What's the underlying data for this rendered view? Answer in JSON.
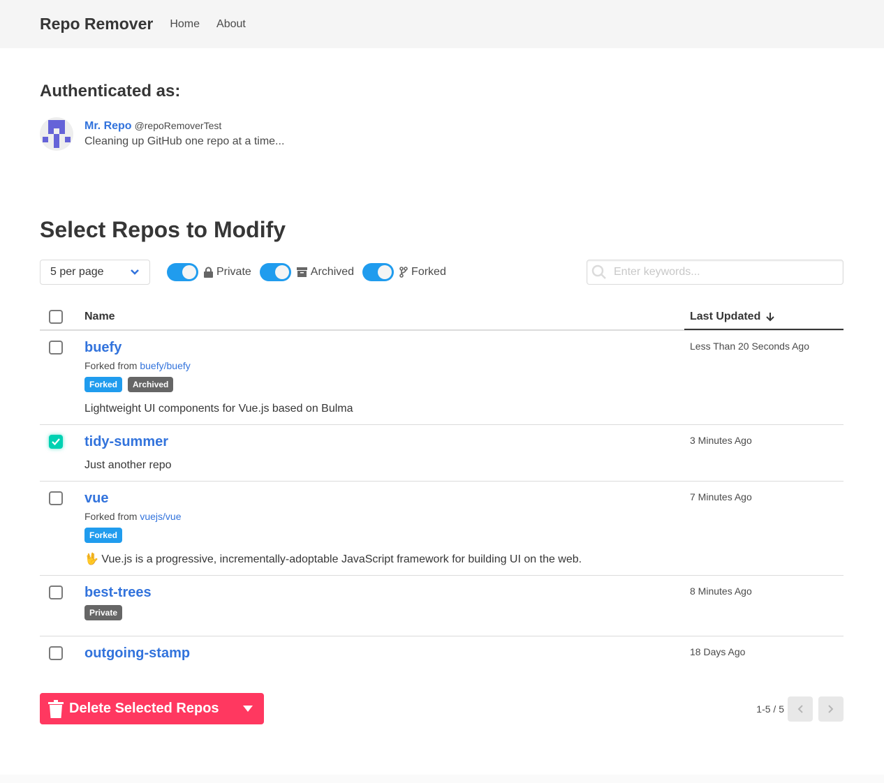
{
  "nav": {
    "brand": "Repo Remover",
    "links": [
      "Home",
      "About"
    ]
  },
  "auth": {
    "heading": "Authenticated as:",
    "name": "Mr. Repo",
    "handle": "@repoRemoverTest",
    "bio": "Cleaning up GitHub one repo at a time..."
  },
  "select": {
    "heading": "Select Repos to Modify",
    "per_page": "5 per page",
    "toggles": [
      {
        "label": "Private",
        "icon": "lock-icon",
        "on": true
      },
      {
        "label": "Archived",
        "icon": "archive-icon",
        "on": true
      },
      {
        "label": "Forked",
        "icon": "fork-icon",
        "on": true
      }
    ],
    "search_placeholder": "Enter keywords..."
  },
  "table": {
    "col_name": "Name",
    "col_updated": "Last Updated",
    "sort": "descending",
    "rows": [
      {
        "name": "buefy",
        "forked_prefix": "Forked from",
        "forked_from": "buefy/buefy",
        "tags": [
          "Forked",
          "Archived"
        ],
        "description": "Lightweight UI components for Vue.js based on Bulma",
        "updated": "Less Than 20 Seconds Ago",
        "checked": false
      },
      {
        "name": "tidy-summer",
        "tags": [],
        "description": "Just another repo",
        "updated": "3 Minutes Ago",
        "checked": true
      },
      {
        "name": "vue",
        "forked_prefix": "Forked from",
        "forked_from": "vuejs/vue",
        "tags": [
          "Forked"
        ],
        "description": "🖖 Vue.js is a progressive, incrementally-adoptable JavaScript framework for building UI on the web.",
        "updated": "7 Minutes Ago",
        "checked": false
      },
      {
        "name": "best-trees",
        "tags": [
          "Private"
        ],
        "updated": "8 Minutes Ago",
        "checked": false
      },
      {
        "name": "outgoing-stamp",
        "tags": [],
        "updated": "18 Days Ago",
        "checked": false
      }
    ]
  },
  "actions": {
    "delete_label": "Delete Selected Repos",
    "pagination": "1-5 / 5"
  },
  "colors": {
    "link": "#3273dc",
    "danger": "#ff3860",
    "info": "#209cee",
    "success": "#00d1b2"
  }
}
